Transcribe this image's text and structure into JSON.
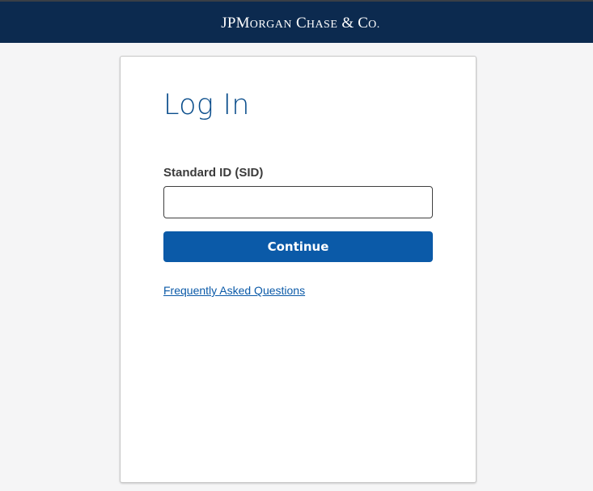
{
  "header": {
    "brand_j": "J",
    "brand_p": "P",
    "brand_m": "M",
    "brand_organ": "ORGAN",
    "brand_c": "C",
    "brand_hase": "HASE",
    "brand_amp": "&",
    "brand_co_c": "C",
    "brand_co_o": "O."
  },
  "login": {
    "title": "Log In",
    "sid_label": "Standard ID (SID)",
    "sid_value": "",
    "continue_label": "Continue",
    "faq_link": "Frequently Asked Questions"
  },
  "colors": {
    "header_bg": "#0c2a4f",
    "accent": "#0b5aa8",
    "title": "#0b4e8c"
  }
}
